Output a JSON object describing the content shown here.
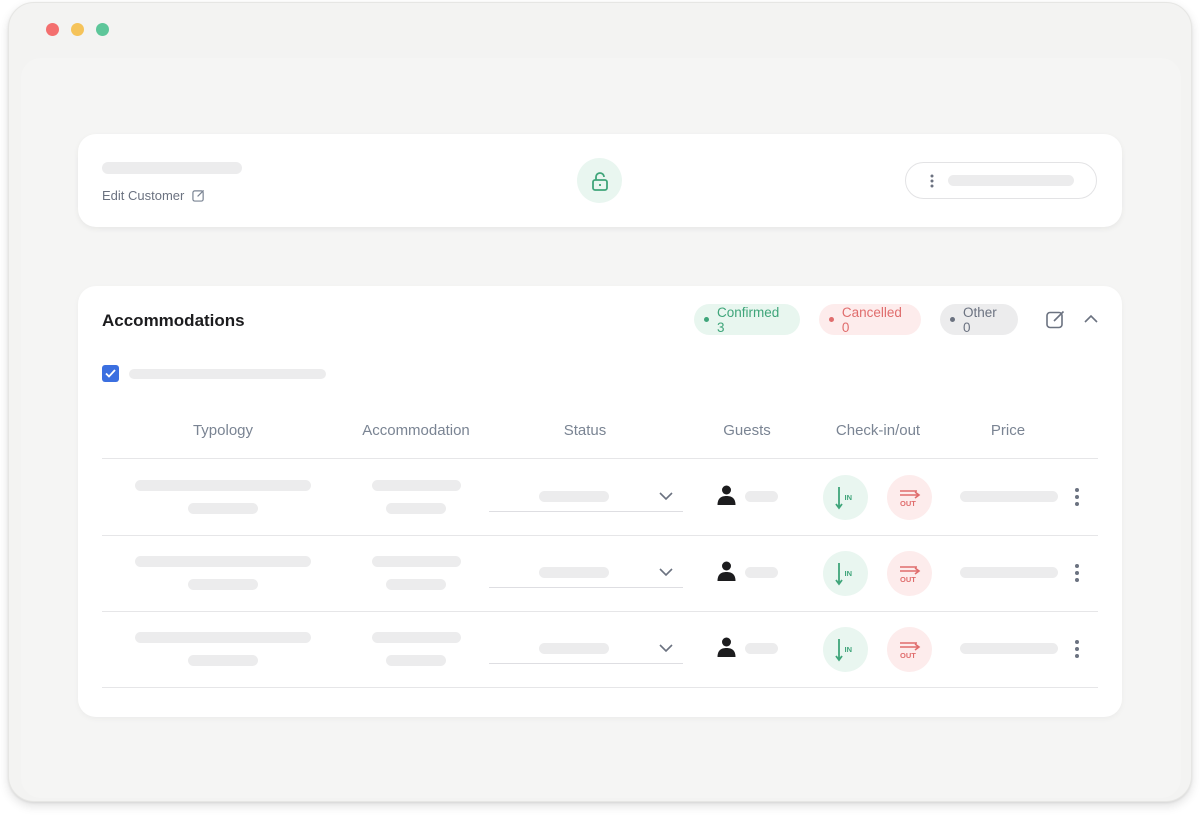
{
  "customer": {
    "edit_label": "Edit Customer"
  },
  "accommodations": {
    "title": "Accommodations",
    "badges": {
      "confirmed": "Confirmed 3",
      "cancelled": "Cancelled 0",
      "other": "Other 0"
    },
    "columns": [
      "Typology",
      "Accommodation",
      "Status",
      "Guests",
      "Check-in/out",
      "Price"
    ],
    "checkin_label": "IN",
    "checkout_label": "OUT"
  },
  "colors": {
    "confirmed": "#3fa57a",
    "cancelled": "#e06d6d",
    "accent": "#3b6fe0"
  },
  "icons": [
    "lock-open-icon",
    "edit-icon",
    "kebab-icon",
    "chevron-up-icon",
    "chevron-down-icon",
    "person-icon",
    "check-in-icon",
    "check-out-icon",
    "checkbox-check-icon"
  ]
}
